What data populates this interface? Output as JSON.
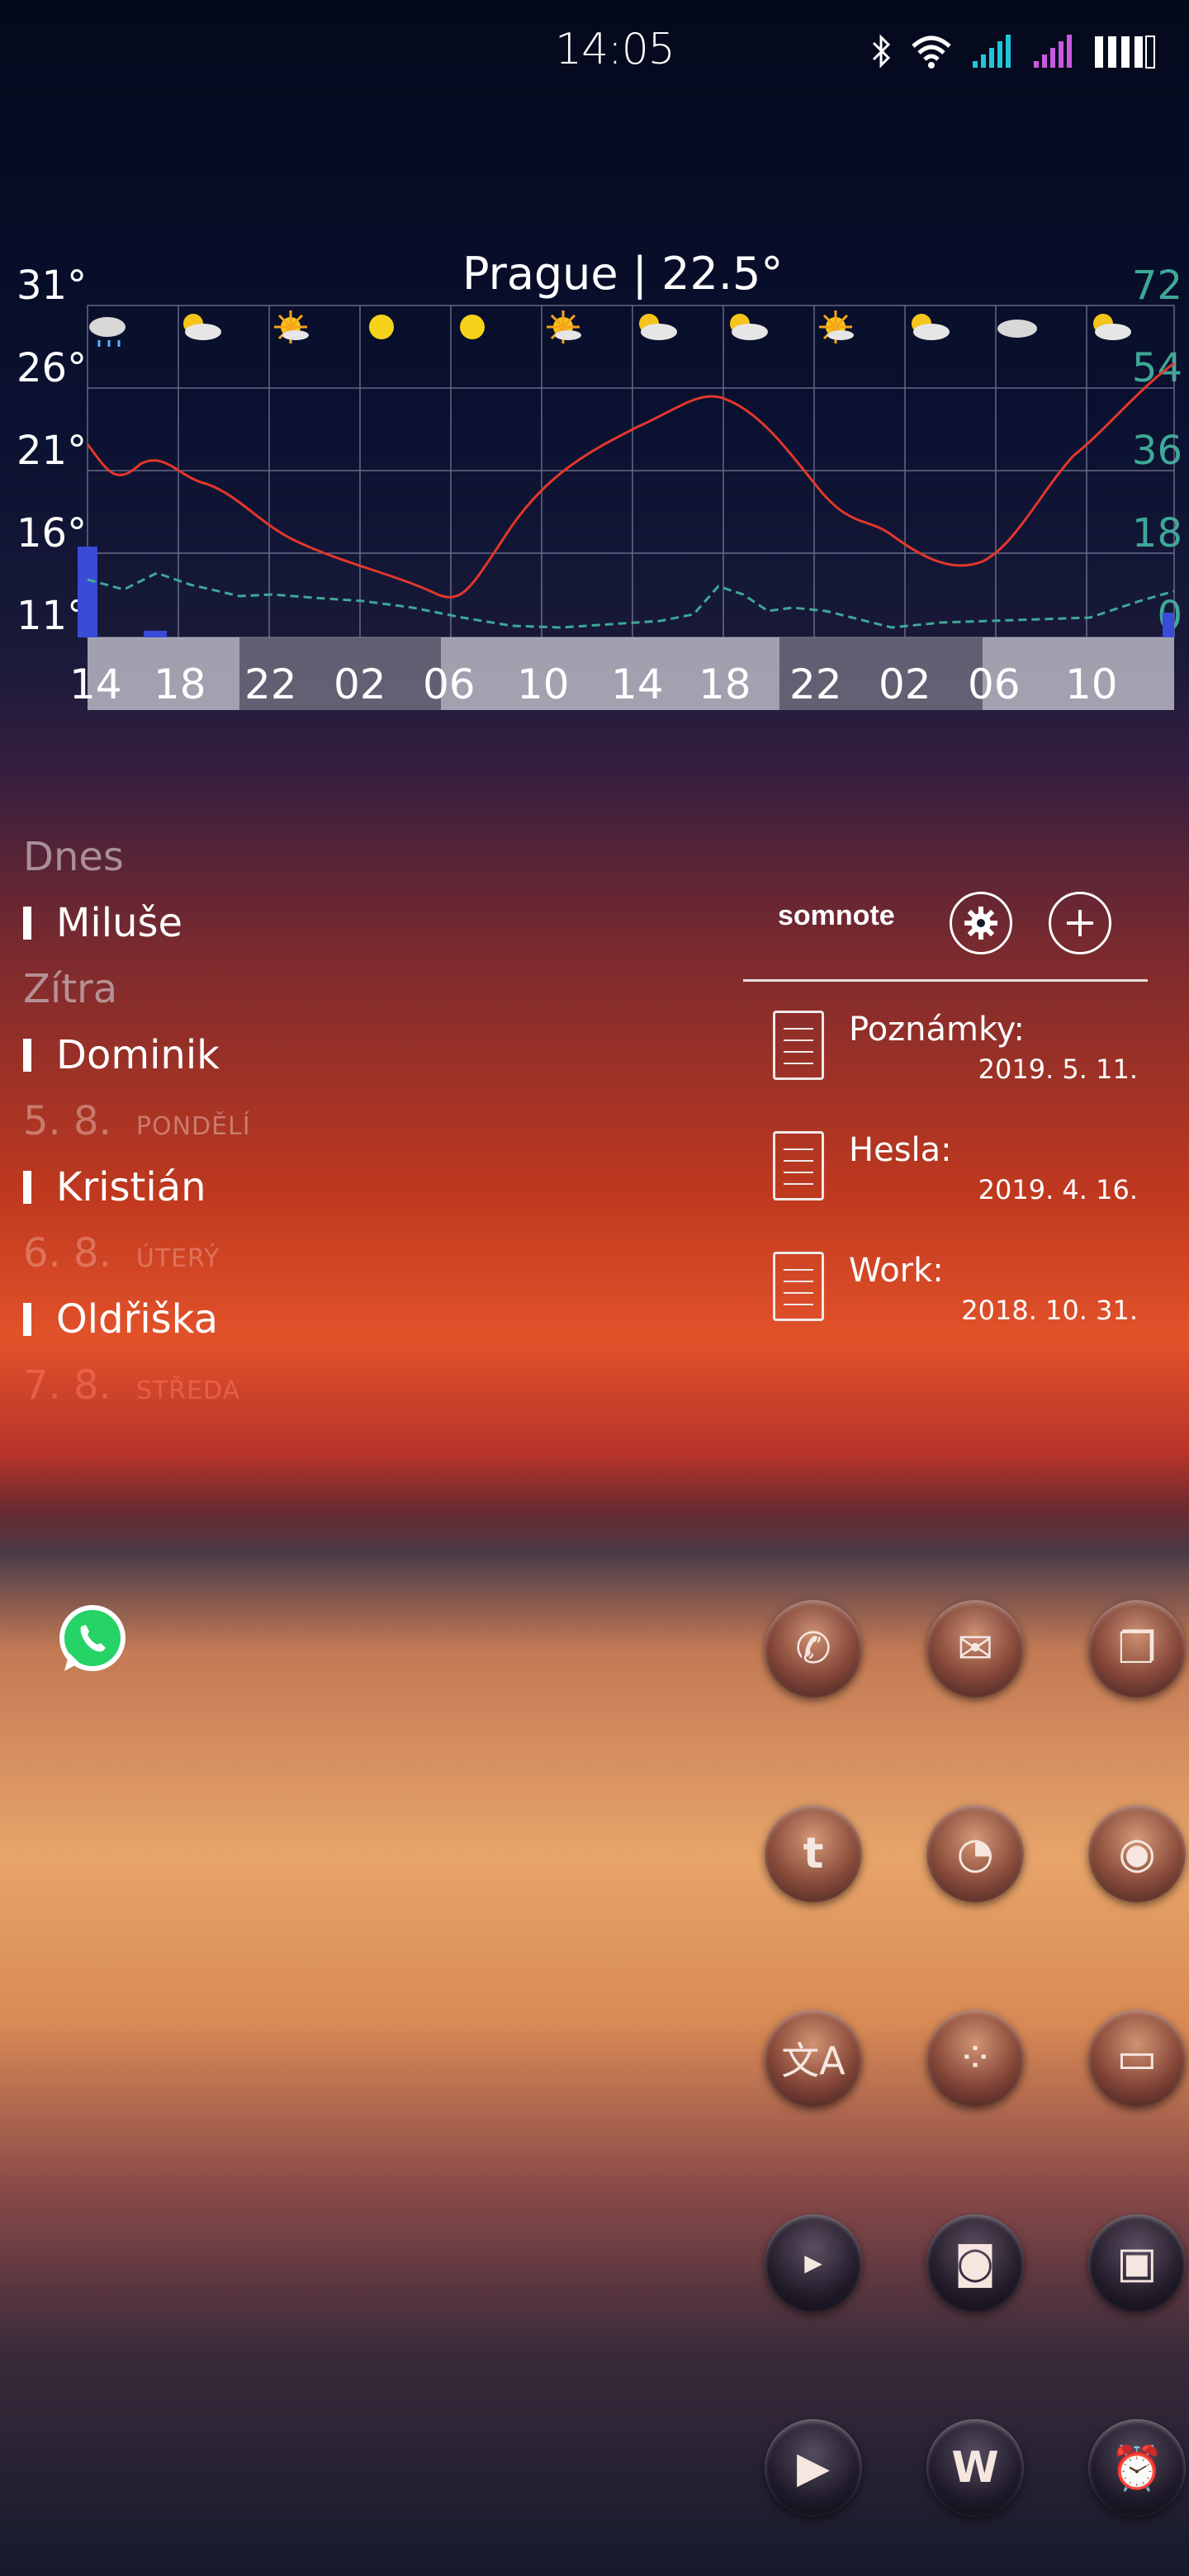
{
  "status_bar": {
    "time": "14:05"
  },
  "weather": {
    "title": "Prague | 22.5°",
    "y_left_ticks": [
      "31°",
      "26°",
      "21°",
      "16°",
      "11°"
    ],
    "y_right_ticks": [
      "72",
      "54",
      "36",
      "18",
      "0"
    ],
    "x_ticks": [
      "14",
      "18",
      "22",
      "02",
      "06",
      "10",
      "14",
      "18",
      "22",
      "02",
      "06",
      "10"
    ],
    "icons": [
      "rain-cloud-icon",
      "sun-cloud-icon",
      "sun-icon",
      "sun-icon",
      "sun-icon",
      "sun-icon",
      "sun-cloud-icon",
      "sun-cloud-icon",
      "sun-icon",
      "sun-cloud-icon",
      "cloud-icon",
      "sun-cloud-icon"
    ],
    "colors": {
      "temp_line": "#e2372b",
      "wind_line": "#3ea897",
      "precip_bar": "#3a4bd8",
      "right_axis": "#3ea897"
    }
  },
  "namedays": {
    "items": [
      {
        "day": "Dnes",
        "name": "Miluše"
      },
      {
        "day": "Zítra",
        "name": "Dominik"
      },
      {
        "date": "5. 8.",
        "weekday": "PONDĚLÍ",
        "name": "Kristián"
      },
      {
        "date": "6. 8.",
        "weekday": "ÚTERÝ",
        "name": "Oldřiška"
      },
      {
        "date": "7. 8.",
        "weekday": "STŘEDA"
      }
    ]
  },
  "somnote": {
    "logo": "somnote",
    "notes": [
      {
        "title": "Poznámky:",
        "date": "2019. 5. 11."
      },
      {
        "title": "Hesla:",
        "date": "2019. 4. 16."
      },
      {
        "title": "Work:",
        "date": "2018. 10. 31."
      }
    ]
  },
  "apps": [
    "phone-icon",
    "mail-icon",
    "clipboard-icon",
    "tumblr-icon",
    "rss-icon",
    "firefox-icon",
    "translate-icon",
    "dots-grid-icon",
    "folder-icon",
    "youtube-icon",
    "camera-icon",
    "gallery-icon",
    "play-icon",
    "word-icon",
    "alarm-clock-icon"
  ]
}
